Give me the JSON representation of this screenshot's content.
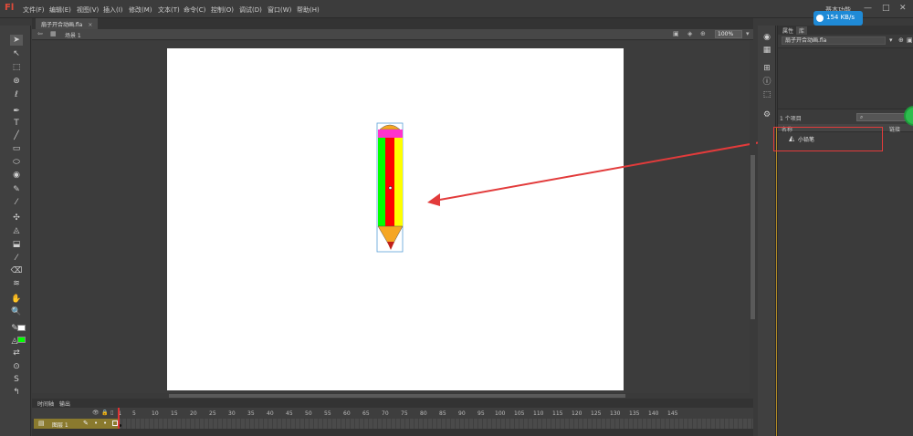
{
  "app": {
    "logo": "Fl",
    "menu": [
      "文件(F)",
      "编辑(E)",
      "视图(V)",
      "插入(I)",
      "修改(M)",
      "文本(T)",
      "命令(C)",
      "控制(O)",
      "调试(D)",
      "窗口(W)",
      "帮助(H)"
    ],
    "workspace": "基本功能",
    "net_speed": "154 KB/s",
    "win_controls": [
      "—",
      "□",
      "✕"
    ]
  },
  "document": {
    "tab_title": "扇子开合动画.fla",
    "tab_close": "×",
    "scene": "场景 1",
    "zoom": "100%"
  },
  "stage": {
    "background": "#ffffff"
  },
  "timeline": {
    "tabs": [
      "时间轴",
      "输出"
    ],
    "current_frame": "1",
    "frame_numbers": [
      "5",
      "10",
      "15",
      "20",
      "25",
      "30",
      "35",
      "40",
      "45",
      "50",
      "55",
      "60",
      "65",
      "70",
      "75",
      "80",
      "85",
      "90",
      "95",
      "100",
      "105",
      "110",
      "115",
      "120",
      "125",
      "130",
      "135",
      "140",
      "145"
    ],
    "layer_name": "图层 1"
  },
  "library": {
    "tabs": [
      "属性",
      "库"
    ],
    "document": "扇子开合动画.fla",
    "item_count": "1 个项目",
    "search_placeholder": "",
    "col_name": "名称",
    "col_linkage": "链接",
    "items": [
      {
        "name": "小铅笔"
      }
    ]
  },
  "colors": {
    "annotation_red": "#e23b3b",
    "pencil_green": "#00ff00",
    "pencil_red": "#ff0000",
    "pencil_yellow": "#ffff00",
    "pencil_pink": "#ff33cc",
    "pencil_orange": "#f5a623",
    "fill_swatch": "#00ff00"
  },
  "icons": {
    "tools": [
      "select-arrow",
      "subselect",
      "free-transform",
      "3d-rotate",
      "lasso",
      "pen",
      "text",
      "line",
      "rectangle",
      "oval",
      "polystar",
      "pencil",
      "brush",
      "deco",
      "bone",
      "paint-bucket",
      "ink-bottle",
      "eyedropper",
      "eraser",
      "width",
      "hand",
      "zoom",
      "stroke-color",
      "fill-color",
      "swap",
      "snap",
      "smooth",
      "straighten"
    ]
  }
}
